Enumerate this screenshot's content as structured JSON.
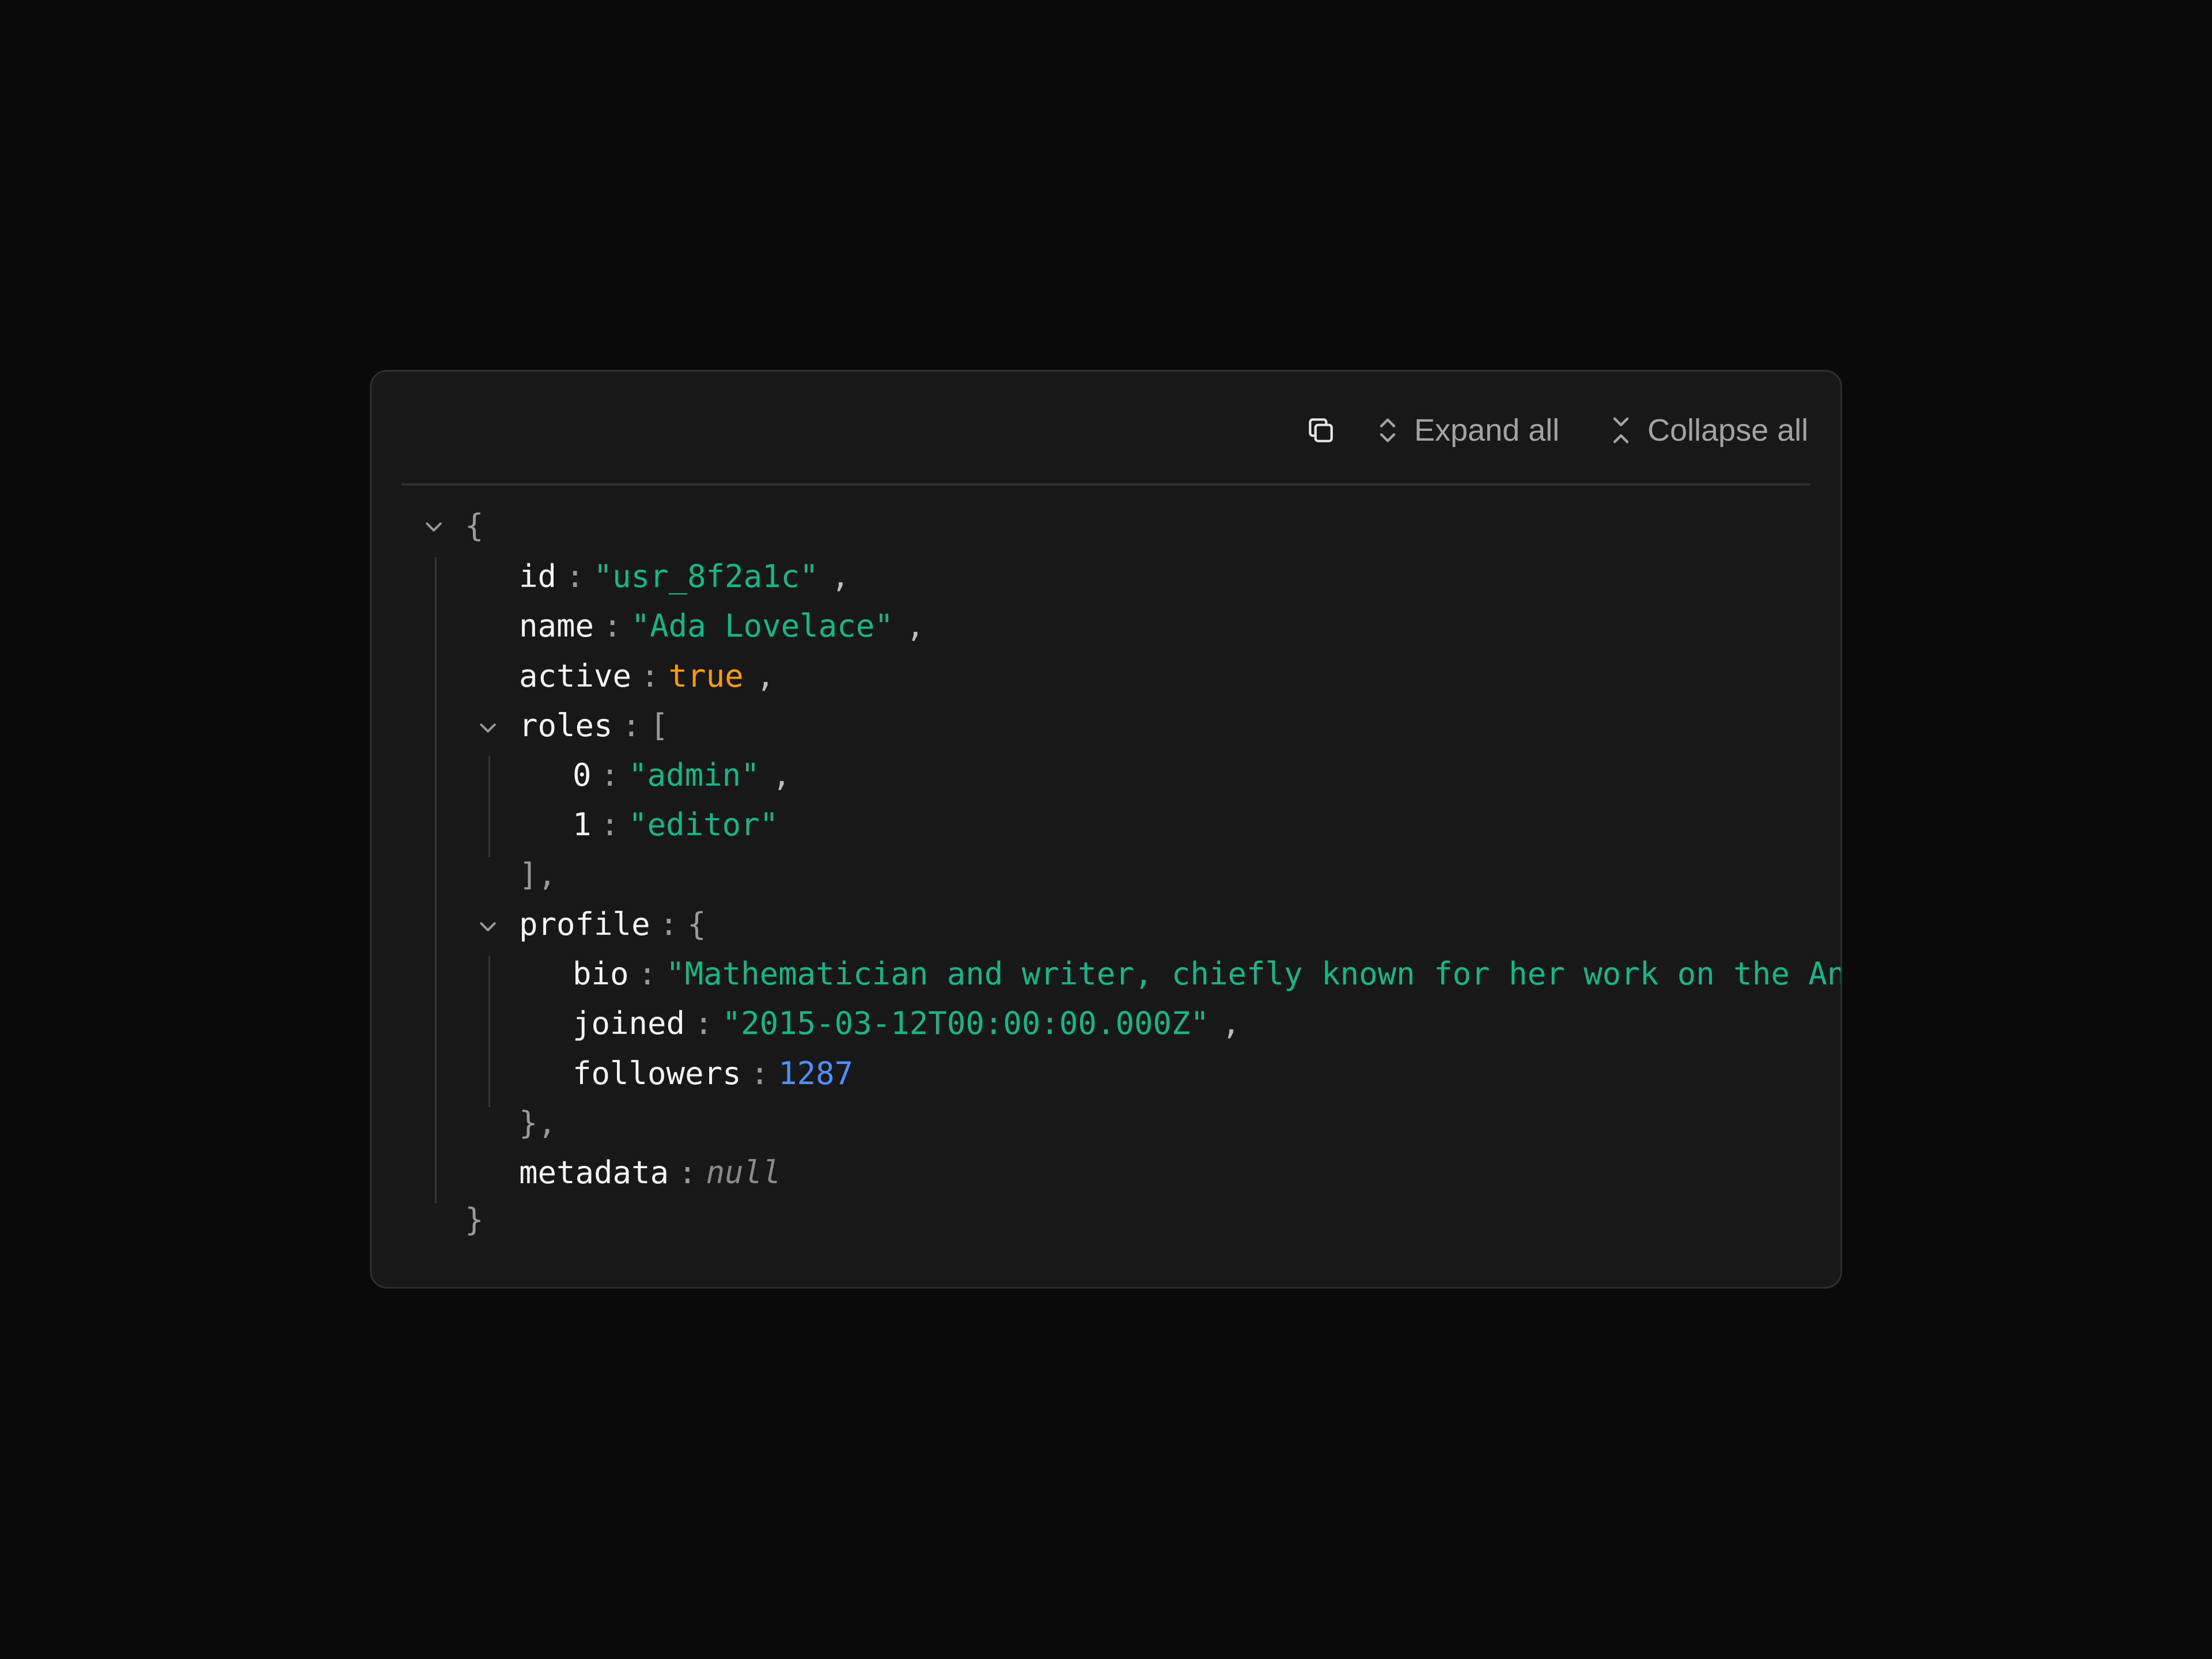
{
  "toolbar": {
    "copy_icon": "copy-icon",
    "expand_label": "Expand all",
    "expand_icon": "chevrons-up-down-icon",
    "collapse_label": "Collapse all",
    "collapse_icon": "chevrons-down-up-icon"
  },
  "tree": {
    "root_open": "{",
    "root_close": "}",
    "id": {
      "key": "id",
      "value": "\"usr_8f2a1c\""
    },
    "name": {
      "key": "name",
      "value": "\"Ada Lovelace\""
    },
    "active": {
      "key": "active",
      "value": "true"
    },
    "roles": {
      "key": "roles",
      "open": "[",
      "close": "],",
      "items": [
        {
          "index": "0",
          "value": "\"admin\""
        },
        {
          "index": "1",
          "value": "\"editor\""
        }
      ]
    },
    "profile": {
      "key": "profile",
      "open": "{",
      "close": "},",
      "bio": {
        "key": "bio",
        "value": "\"Mathematician and writer, chiefly known for her work on the Ana"
      },
      "joined": {
        "key": "joined",
        "value": "\"2015-03-12T00:00:00.000Z\""
      },
      "followers": {
        "key": "followers",
        "value": "1287"
      }
    },
    "metadata": {
      "key": "metadata",
      "value": "null"
    },
    "separator_colon": ":",
    "separator_comma": ","
  },
  "colors": {
    "background": "#0a0a0a",
    "panel": "#181818",
    "string": "#12b886",
    "boolean": "#f59f00",
    "number": "#4d8ff5",
    "null": "#8a8a8a",
    "key": "#f4f4f4"
  }
}
